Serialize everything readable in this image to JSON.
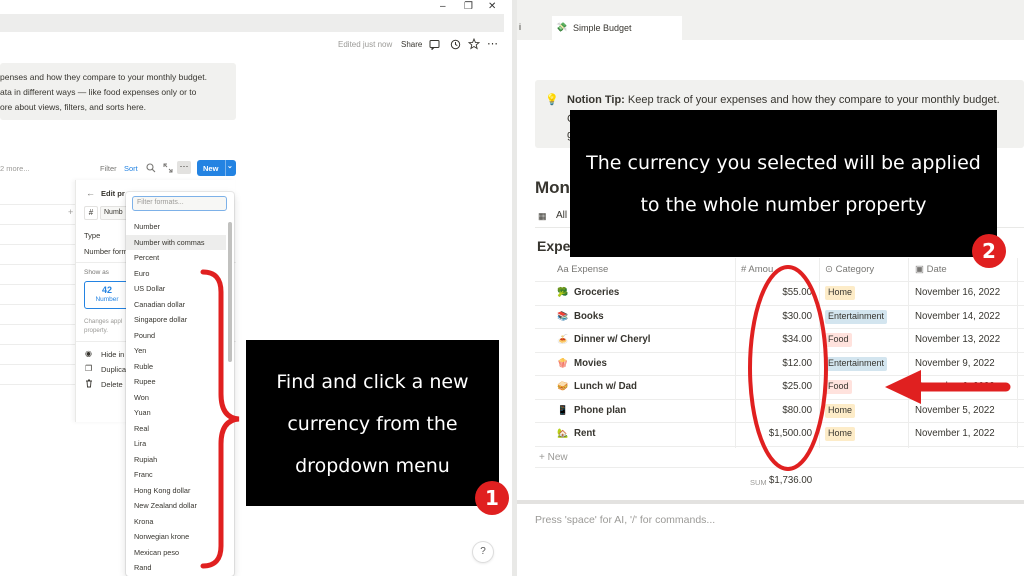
{
  "left": {
    "window_controls": [
      "–",
      "❐",
      "✕"
    ],
    "topbar": {
      "edited": "Edited just now",
      "share": "Share"
    },
    "tip_lines": [
      "penses and how they compare to your monthly budget.",
      "ata in different ways — like food expenses only or to",
      "ore about views, filters, and sorts here."
    ],
    "more_label": "2 more...",
    "viewbar": {
      "filter": "Filter",
      "sort": "Sort",
      "new_label": "New"
    },
    "edit_panel": {
      "title": "Edit pr",
      "name_value": "Numb",
      "type_label": "Type",
      "number_format_label": "Number form",
      "show_as_label": "Show as",
      "card_value": "42",
      "card_label": "Number",
      "changes_note_1": "Changes appl",
      "changes_note_2": "property.",
      "hide_label": "Hide in",
      "duplicate_label": "Duplica",
      "delete_label": "Delete"
    },
    "dropdown": {
      "placeholder": "Filter formats...",
      "items": [
        "Number",
        "Number with commas",
        "Percent",
        "Euro",
        "US Dollar",
        "Canadian dollar",
        "Singapore dollar",
        "Pound",
        "Yen",
        "Ruble",
        "Rupee",
        "Won",
        "Yuan",
        "Real",
        "Lira",
        "Rupiah",
        "Franc",
        "Hong Kong dollar",
        "New Zealand dollar",
        "Krona",
        "Norwegian krone",
        "Mexican peso",
        "Rand"
      ],
      "highlighted": "Number with commas"
    },
    "annotation": {
      "lines": [
        "Find and click a new",
        "currency from the",
        "dropdown menu"
      ],
      "step": "1"
    }
  },
  "right": {
    "tab_prev": "i",
    "tab_title": "Simple Budget",
    "tip_prefix": "Notion Tip:",
    "tip_text": " Keep track of your expenses and how they compare to your monthly budget.",
    "tip_line2_start": "C",
    "tip_line3_start": "g",
    "heading_partial": "Mon",
    "view_partial": "All",
    "table_title_partial": "Expe",
    "columns": {
      "expense": "Expense",
      "amount": "Amou",
      "category": "Category",
      "date": "Date"
    },
    "column_prefixes": {
      "expense": "Aa",
      "amount": "#"
    },
    "rows": [
      {
        "icon": "🥦",
        "expense": "Groceries",
        "amount": "$55.00",
        "category": "Home",
        "date": "November 16, 2022"
      },
      {
        "icon": "📚",
        "expense": "Books",
        "amount": "$30.00",
        "category": "Entertainment",
        "date": "November 14, 2022"
      },
      {
        "icon": "🍝",
        "expense": "Dinner w/ Cheryl",
        "amount": "$34.00",
        "category": "Food",
        "date": "November 13, 2022"
      },
      {
        "icon": "🍿",
        "expense": "Movies",
        "amount": "$12.00",
        "category": "Entertainment",
        "date": "November 9, 2022"
      },
      {
        "icon": "🥪",
        "expense": "Lunch w/ Dad",
        "amount": "$25.00",
        "category": "Food",
        "date": "November 6, 2022"
      },
      {
        "icon": "📱",
        "expense": "Phone plan",
        "amount": "$80.00",
        "category": "Home",
        "date": "November 5, 2022"
      },
      {
        "icon": "🏡",
        "expense": "Rent",
        "amount": "$1,500.00",
        "category": "Home",
        "date": "November 1, 2022"
      }
    ],
    "new_row_label": "New",
    "sum_label": "SUM",
    "sum_value": "$1,736.00",
    "command_placeholder": "Press 'space' for AI, '/' for commands...",
    "annotation": {
      "lines": [
        "The currency you selected will be applied",
        "to the whole number property"
      ],
      "step": "2"
    }
  },
  "colors": {
    "accent_blue": "#2383e2",
    "annotation_red": "#e02020",
    "tag_home": "#fdecc8",
    "tag_food": "#ffe2dd",
    "tag_entertainment": "#d3e5ef"
  }
}
